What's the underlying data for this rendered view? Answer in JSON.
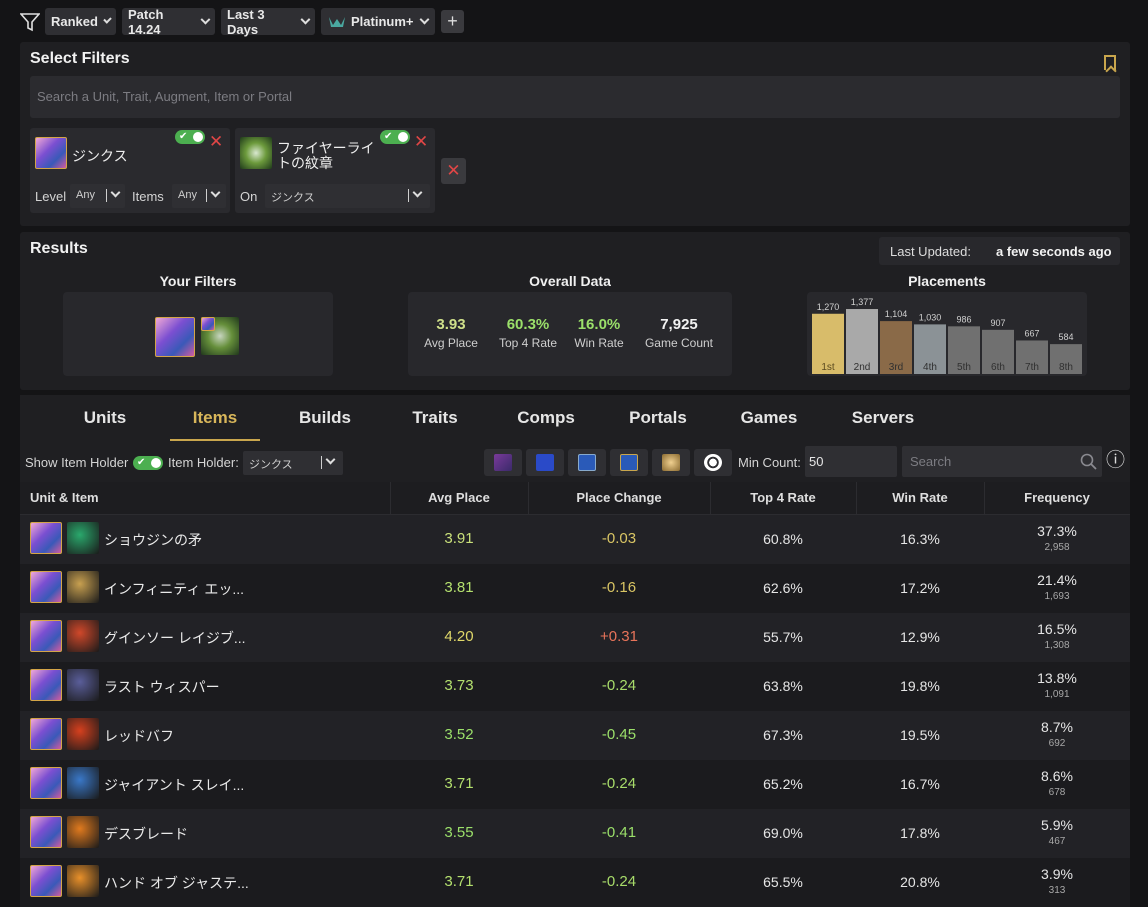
{
  "topbar": {
    "mode": "Ranked",
    "patch": "Patch 14.24",
    "period": "Last 3 Days",
    "rank": "Platinum+",
    "add_label": "+"
  },
  "filters": {
    "title": "Select Filters",
    "search_placeholder": "Search a Unit, Trait, Augment, Item or Portal",
    "unit_filter": {
      "name": "ジンクス",
      "level_label": "Level",
      "level_value": "Any",
      "items_label": "Items",
      "items_value": "Any"
    },
    "item_filter": {
      "name_line1": "ファイヤーライ",
      "name_line2": "トの紋章",
      "on_label": "On",
      "on_value": "ジンクス"
    }
  },
  "results": {
    "title": "Results",
    "last_updated_label": "Last Updated:",
    "last_updated_value": "a few seconds ago",
    "your_filters_title": "Your Filters",
    "overall_title": "Overall Data",
    "overall": [
      {
        "value": "3.93",
        "label": "Avg Place",
        "color": "#cfe08a"
      },
      {
        "value": "60.3%",
        "label": "Top 4 Rate",
        "color": "#9be06a"
      },
      {
        "value": "16.0%",
        "label": "Win Rate",
        "color": "#9be06a"
      },
      {
        "value": "7,925",
        "label": "Game Count",
        "color": "#f2f2f2"
      }
    ],
    "placements_title": "Placements"
  },
  "chart_data": {
    "type": "bar",
    "categories": [
      "1st",
      "2nd",
      "3rd",
      "4th",
      "5th",
      "6th",
      "7th",
      "8th"
    ],
    "values": [
      1270,
      1377,
      1104,
      1030,
      986,
      907,
      667,
      584
    ],
    "value_labels": [
      "1,270",
      "1,377",
      "1,104",
      "1,030",
      "986",
      "907",
      "667",
      "584"
    ],
    "colors": [
      "#d8bc6a",
      "#a9a9a9",
      "#8a6a48",
      "#8b9296",
      "#707070",
      "#707070",
      "#707070",
      "#707070"
    ]
  },
  "tabs": [
    "Units",
    "Items",
    "Builds",
    "Traits",
    "Comps",
    "Portals",
    "Games",
    "Servers"
  ],
  "active_tab": "Items",
  "toolbar": {
    "show_holder_label": "Show Item Holder",
    "holder_label": "Item Holder:",
    "holder_value": "ジンクス",
    "min_count_label": "Min Count:",
    "min_count_value": "50",
    "search_placeholder": "Search",
    "info_icon": "ⓘ"
  },
  "table": {
    "headers": [
      "Unit & Item",
      "Avg Place",
      "Place Change",
      "Top 4 Rate",
      "Win Rate",
      "Frequency"
    ],
    "rows": [
      {
        "item": "ショウジンの矛",
        "avg": "3.91",
        "change": "-0.03",
        "top4": "60.8%",
        "win": "16.3%",
        "freq": "37.3%",
        "count": "2,958",
        "avg_color": "#c9e07a",
        "change_color": "#d9c564",
        "icon": "#2aa86c"
      },
      {
        "item": "インフィニティ エッ...",
        "avg": "3.81",
        "change": "-0.16",
        "top4": "62.6%",
        "win": "17.2%",
        "freq": "21.4%",
        "count": "1,693",
        "avg_color": "#b4e06e",
        "change_color": "#d9c564",
        "icon": "#c8a050"
      },
      {
        "item": "グインソー レイジブ...",
        "avg": "4.20",
        "change": "+0.31",
        "top4": "55.7%",
        "win": "12.9%",
        "freq": "16.5%",
        "count": "1,308",
        "avg_color": "#e0d86a",
        "change_color": "#e8745a",
        "icon": "#d0482a"
      },
      {
        "item": "ラスト ウィスパー",
        "avg": "3.73",
        "change": "-0.24",
        "top4": "63.8%",
        "win": "19.8%",
        "freq": "13.8%",
        "count": "1,091",
        "avg_color": "#b4e06e",
        "change_color": "#a8dc6a",
        "icon": "#5a5e9a"
      },
      {
        "item": "レッドバフ",
        "avg": "3.52",
        "change": "-0.45",
        "top4": "67.3%",
        "win": "19.5%",
        "freq": "8.7%",
        "count": "692",
        "avg_color": "#9be06a",
        "change_color": "#9be06a",
        "icon": "#d6401e"
      },
      {
        "item": "ジャイアント スレイ...",
        "avg": "3.71",
        "change": "-0.24",
        "top4": "65.2%",
        "win": "16.7%",
        "freq": "8.6%",
        "count": "678",
        "avg_color": "#b4e06e",
        "change_color": "#a8dc6a",
        "icon": "#3a78c8"
      },
      {
        "item": "デスブレード",
        "avg": "3.55",
        "change": "-0.41",
        "top4": "69.0%",
        "win": "17.8%",
        "freq": "5.9%",
        "count": "467",
        "avg_color": "#9be06a",
        "change_color": "#9be06a",
        "icon": "#e07a1e"
      },
      {
        "item": "ハンド オブ ジャステ...",
        "avg": "3.71",
        "change": "-0.24",
        "top4": "65.5%",
        "win": "20.8%",
        "freq": "3.9%",
        "count": "313",
        "avg_color": "#b4e06e",
        "change_color": "#a8dc6a",
        "icon": "#e8902a"
      }
    ]
  }
}
